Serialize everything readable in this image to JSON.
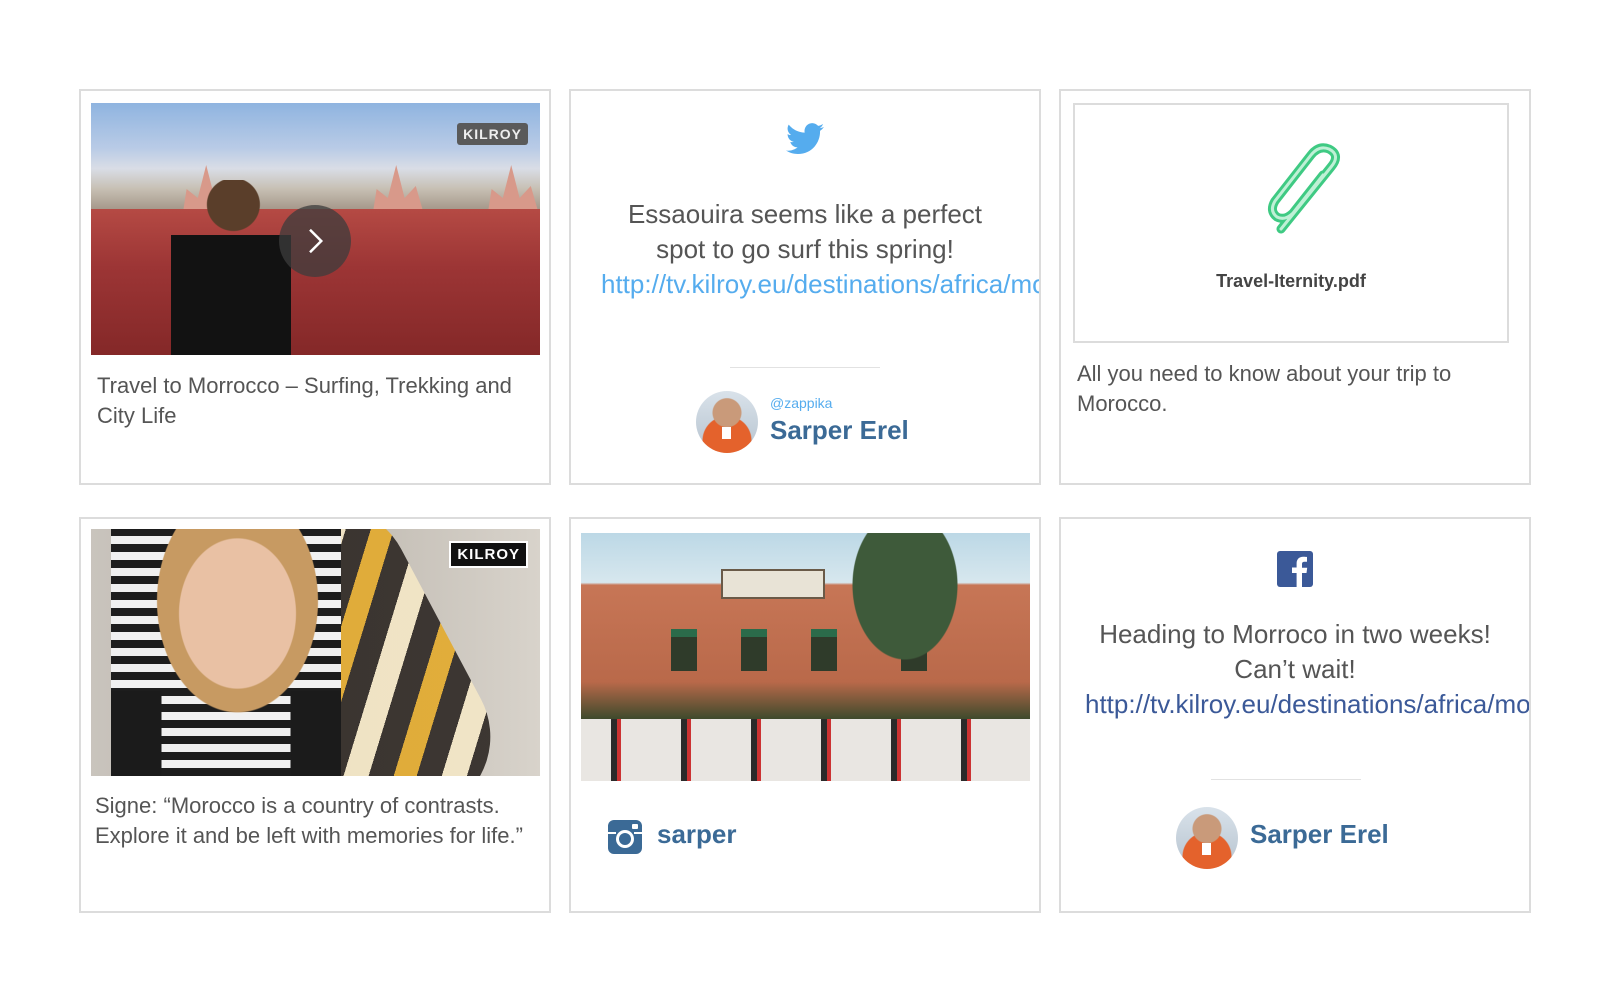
{
  "cards": {
    "video1": {
      "badge": "KILROY",
      "caption": "Travel to Morrocco – Surfing, Trekking and City Life"
    },
    "tweet": {
      "text": "Essaouira seems like a perfect spot to go surf this spring! ",
      "link": "http://tv.kilroy.eu/destinations/africa/morocco",
      "handle": "@zappika",
      "author": "Sarper Erel",
      "icon": "twitter-icon"
    },
    "pdf": {
      "filename": "Travel-Iternity.pdf",
      "description": "All you need to know about your trip to Morocco.",
      "icon": "paperclip-icon"
    },
    "video2": {
      "badge": "KILROY",
      "caption": "Signe: “Morocco is a country of contrasts. Explore it and be left with memories for life.”"
    },
    "instagram": {
      "username": "sarper",
      "icon": "instagram-icon"
    },
    "facebook": {
      "text": "Heading to Morroco in two weeks! Can’t wait! ",
      "link": "http://tv.kilroy.eu/destinations/africa/morocco",
      "author": "Sarper Erel",
      "icon": "facebook-icon"
    }
  },
  "colors": {
    "twitter": "#55acee",
    "facebook": "#3b5998",
    "author": "#3b6a96",
    "paperclip": "#3fca83",
    "border": "#dcdcdc"
  }
}
